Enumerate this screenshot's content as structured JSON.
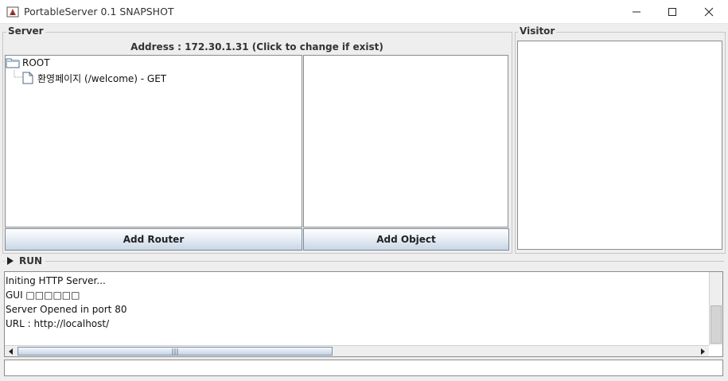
{
  "window": {
    "title": "PortableServer 0.1 SNAPSHOT",
    "controls": [
      "minimize",
      "maximize",
      "close"
    ]
  },
  "server": {
    "group_title": "Server",
    "address_label": "Address : 172.30.1.31 (Click to change if exist)",
    "tree": {
      "root": "ROOT",
      "children": [
        {
          "label": "환영페이지 (/welcome) - GET",
          "icon": "file-icon"
        }
      ]
    },
    "add_router_label": "Add Router",
    "add_object_label": "Add Object"
  },
  "visitor": {
    "group_title": "Visitor"
  },
  "run": {
    "label": "RUN",
    "log_lines": [
      "Initing HTTP Server...",
      "GUI □□□□□□",
      "Server Opened in port 80",
      "URL : http://localhost/"
    ],
    "input_value": ""
  }
}
